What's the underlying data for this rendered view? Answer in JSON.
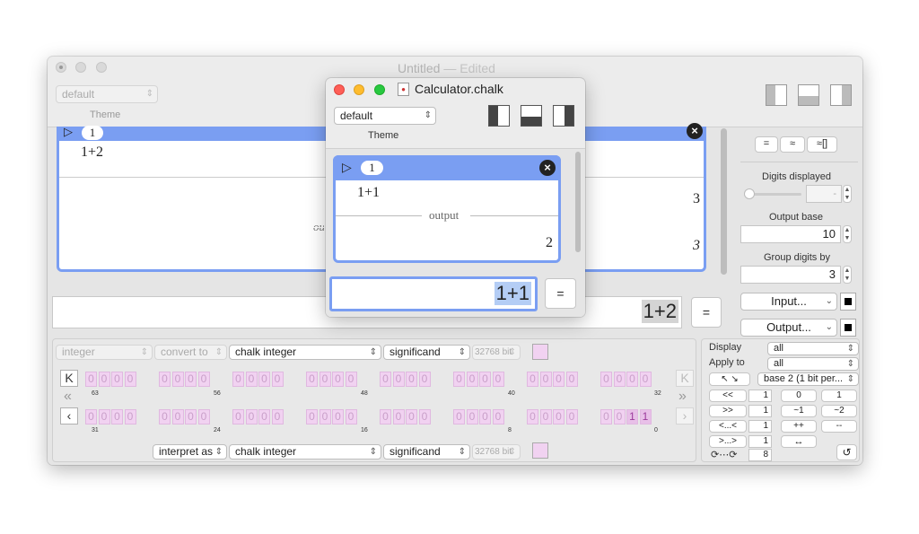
{
  "main_window": {
    "title": "Untitled",
    "title_suffix": "— Edited",
    "theme_value": "default",
    "theme_label": "Theme",
    "cell": {
      "number": "1",
      "input": "1+2",
      "output_label": "output",
      "output_value": "3",
      "output_value_italic": "3"
    },
    "input_expression": "1+2",
    "equals_label": "="
  },
  "right_panel": {
    "mode_buttons": [
      "=",
      "≈",
      "≈[]"
    ],
    "digits_displayed_label": "Digits displayed",
    "digits_displayed_value": "-",
    "output_base_label": "Output base",
    "output_base_value": "10",
    "group_digits_label": "Group digits by",
    "group_digits_value": "3",
    "input_popup": "Input...",
    "output_popup": "Output..."
  },
  "bits_panel": {
    "top_row": {
      "type_popup": "integer",
      "convert_popup": "convert to",
      "kind_popup": "chalk integer",
      "part_popup": "significand",
      "bits_field": "32768 bit"
    },
    "bottom_row": {
      "interpret_popup": "interpret as",
      "kind_popup": "chalk integer",
      "part_popup": "significand",
      "bits_field": "32768 bit"
    },
    "high_word_bits": "0000000000000000000000000000000000000000000000000000000000000000",
    "high_labels": [
      "63",
      "56",
      "48",
      "40",
      "32"
    ],
    "low_word_bits": "00000000000000000000000000000011",
    "low_labels": [
      "31",
      "24",
      "16",
      "8",
      "0"
    ],
    "display_label": "Display",
    "display_value": "all",
    "apply_label": "Apply to",
    "apply_value": "all",
    "base_value": "base 2 (1 bit per...",
    "shift_ops": [
      "<<",
      ">>",
      "<...<",
      ">...>"
    ],
    "shift_values": [
      "1",
      "1",
      "1",
      "1"
    ],
    "rotate_value": "8",
    "bit_ops": [
      "0",
      "1",
      "~1",
      "~2",
      "++",
      "--"
    ],
    "swap_label": "↔"
  },
  "calculator_window": {
    "title": "Calculator.chalk",
    "theme_value": "default",
    "theme_label": "Theme",
    "cell": {
      "number": "1",
      "input": "1+1",
      "output_label": "output",
      "output_value": "2"
    },
    "input_expression": "1+1",
    "equals_label": "="
  },
  "colors": {
    "cell_header": "#7a9ef2",
    "selection": "#b4cdf5",
    "bit_bg": "#f1d2f1",
    "close_red": "#fe5f57",
    "minimize_yellow": "#febc2e",
    "zoom_green": "#28c840"
  }
}
